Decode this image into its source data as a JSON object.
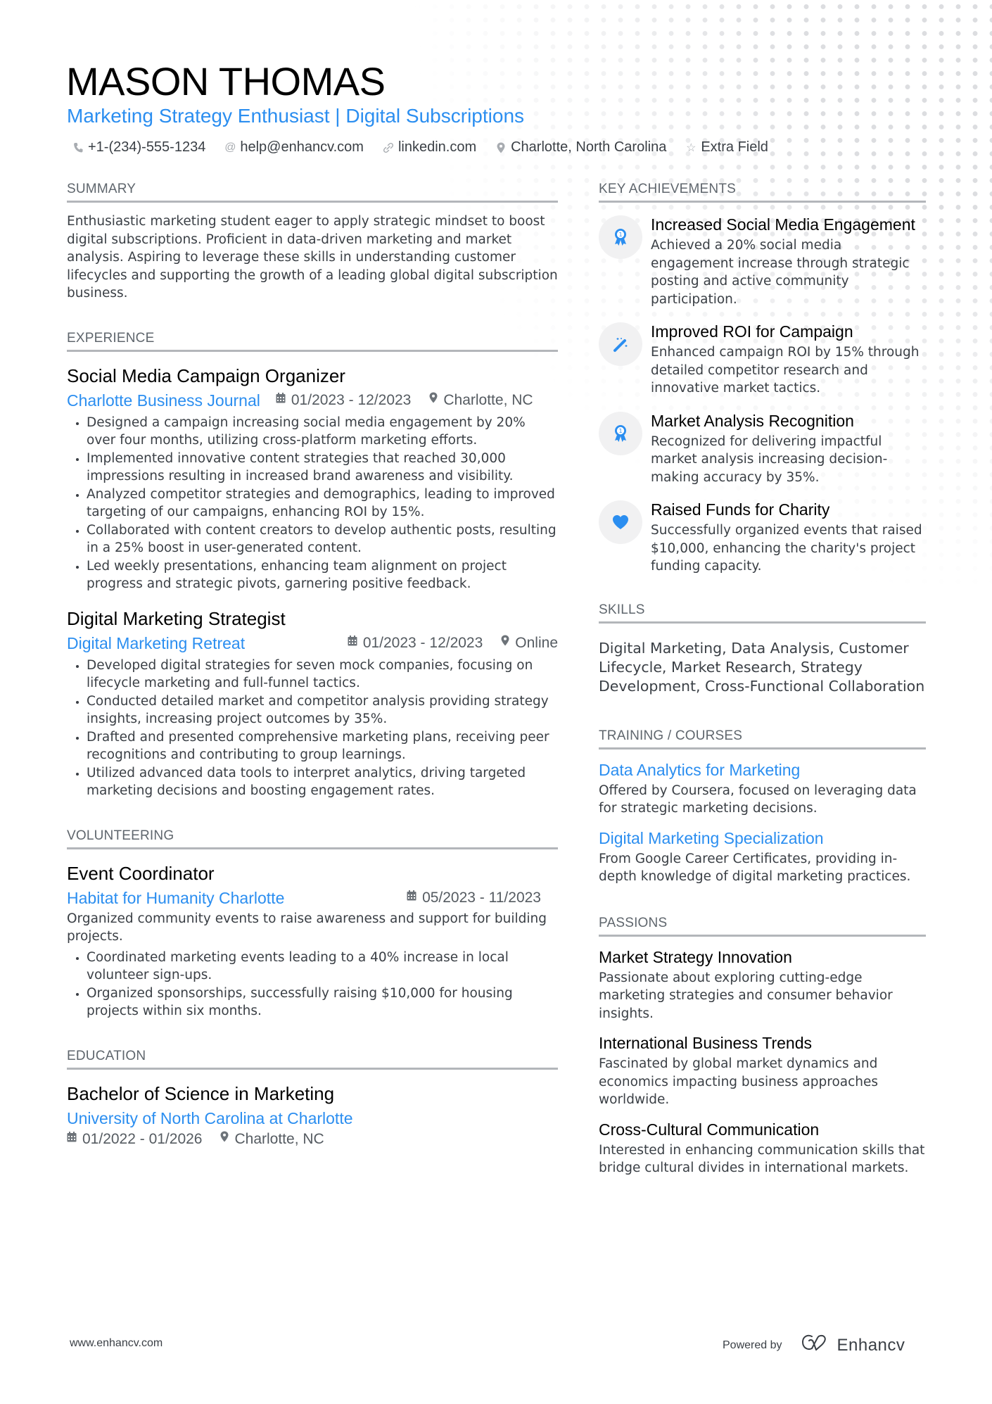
{
  "header": {
    "name": "MASON THOMAS",
    "title": "Marketing Strategy Enthusiast | Digital Subscriptions",
    "contacts": [
      {
        "icon": "phone-icon",
        "text": "+1-(234)-555-1234"
      },
      {
        "icon": "at-icon",
        "text": "help@enhancv.com"
      },
      {
        "icon": "link-icon",
        "text": "linkedin.com"
      },
      {
        "icon": "location-pin-icon",
        "text": "Charlotte, North Carolina"
      },
      {
        "icon": "star-icon",
        "text": "Extra Field"
      }
    ]
  },
  "summary": {
    "heading": "SUMMARY",
    "text": "Enthusiastic marketing student eager to apply strategic mindset to boost digital subscriptions. Proficient in data-driven marketing and market analysis. Aspiring to leverage these skills in understanding customer lifecycles and supporting the growth of a leading global digital subscription business."
  },
  "experience": {
    "heading": "EXPERIENCE",
    "items": [
      {
        "role": "Social Media Campaign Organizer",
        "company": "Charlotte Business Journal",
        "dates": "01/2023 - 12/2023",
        "location": "Charlotte, NC",
        "bullets": [
          "Designed a campaign increasing social media engagement by 20% over four months, utilizing cross-platform marketing efforts.",
          "Implemented innovative content strategies that reached 30,000 impressions resulting in increased brand awareness and visibility.",
          "Analyzed competitor strategies and demographics, leading to improved targeting of our campaigns, enhancing ROI by 15%.",
          "Collaborated with content creators to develop authentic posts, resulting in a 25% boost in user-generated content.",
          "Led weekly presentations, enhancing team alignment on project progress and strategic pivots, garnering positive feedback."
        ]
      },
      {
        "role": "Digital Marketing Strategist",
        "company": "Digital Marketing Retreat",
        "dates": "01/2023 - 12/2023",
        "location": "Online",
        "bullets": [
          "Developed digital strategies for seven mock companies, focusing on lifecycle marketing and full-funnel tactics.",
          "Conducted detailed market and competitor analysis providing strategy insights, increasing project outcomes by 35%.",
          "Drafted and presented comprehensive marketing plans, receiving peer recognitions and contributing to group learnings.",
          "Utilized advanced data tools to interpret analytics, driving targeted marketing decisions and boosting engagement rates."
        ]
      }
    ]
  },
  "volunteering": {
    "heading": "VOLUNTEERING",
    "items": [
      {
        "role": "Event Coordinator",
        "company": "Habitat for Humanity Charlotte",
        "dates": "05/2023 - 11/2023",
        "description": "Organized community events to raise awareness and support for building projects.",
        "bullets": [
          "Coordinated marketing events leading to a 40% increase in local volunteer sign-ups.",
          "Organized sponsorships, successfully raising $10,000 for housing projects within six months."
        ]
      }
    ]
  },
  "education": {
    "heading": "EDUCATION",
    "items": [
      {
        "degree": "Bachelor of Science in Marketing",
        "school": "University of North Carolina at Charlotte",
        "dates": "01/2022 - 01/2026",
        "location": "Charlotte, NC"
      }
    ]
  },
  "achievements": {
    "heading": "KEY ACHIEVEMENTS",
    "items": [
      {
        "icon": "award-ribbon-icon",
        "title": "Increased Social Media Engagement",
        "text": "Achieved a 20% social media engagement increase through strategic posting and active community participation."
      },
      {
        "icon": "magic-wand-icon",
        "title": "Improved ROI for Campaign",
        "text": "Enhanced campaign ROI by 15% through detailed competitor research and innovative market tactics."
      },
      {
        "icon": "award-ribbon-icon",
        "title": "Market Analysis Recognition",
        "text": "Recognized for delivering impactful market analysis increasing decision-making accuracy by 35%."
      },
      {
        "icon": "heart-icon",
        "title": "Raised Funds for Charity",
        "text": "Successfully organized events that raised $10,000, enhancing the charity's project funding capacity."
      }
    ]
  },
  "skills": {
    "heading": "SKILLS",
    "text": "Digital Marketing, Data Analysis, Customer Lifecycle, Market Research, Strategy Development, Cross-Functional Collaboration"
  },
  "training": {
    "heading": "TRAINING / COURSES",
    "items": [
      {
        "title": "Data Analytics for Marketing",
        "text": "Offered by Coursera, focused on leveraging data for strategic marketing decisions."
      },
      {
        "title": "Digital Marketing Specialization",
        "text": "From Google Career Certificates, providing in-depth knowledge of digital marketing practices."
      }
    ]
  },
  "passions": {
    "heading": "PASSIONS",
    "items": [
      {
        "title": "Market Strategy Innovation",
        "text": "Passionate about exploring cutting-edge marketing strategies and consumer behavior insights."
      },
      {
        "title": "International Business Trends",
        "text": "Fascinated by global market dynamics and economics impacting business approaches worldwide."
      },
      {
        "title": "Cross-Cultural Communication",
        "text": "Interested in enhancing communication skills that bridge cultural divides in international markets."
      }
    ]
  },
  "footer": {
    "website": "www.enhancv.com",
    "powered_by": "Powered by",
    "brand": "Enhancv"
  },
  "colors": {
    "accent": "#2b8ef0",
    "heading_rule": "#b3b6ba",
    "text": "#3a3f45"
  }
}
